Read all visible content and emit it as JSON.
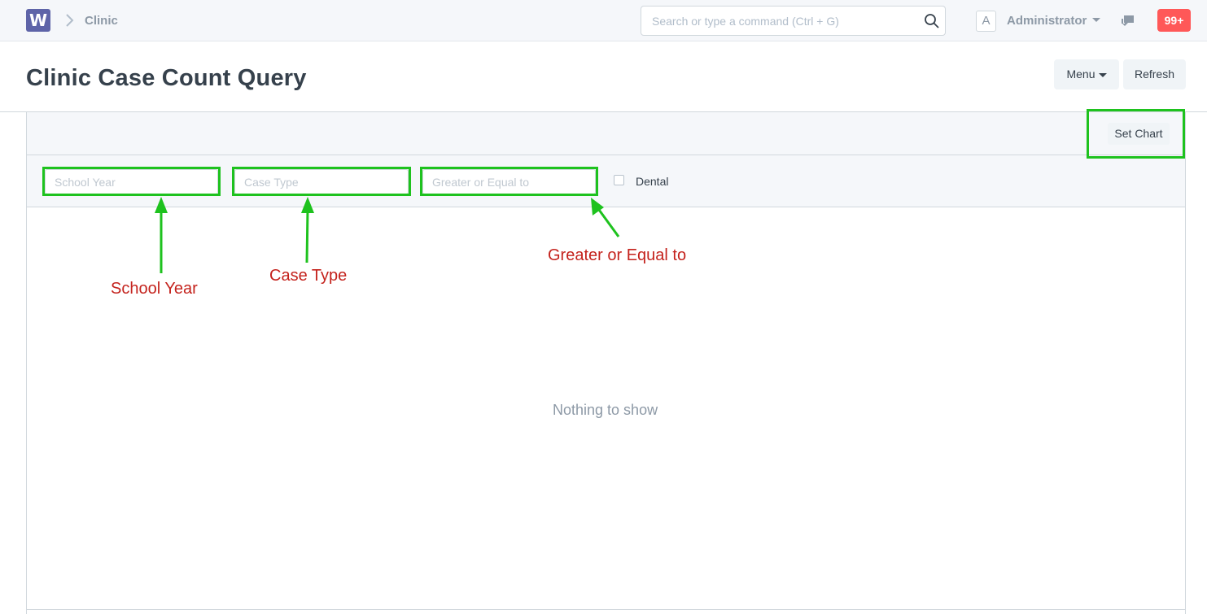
{
  "navbar": {
    "logo_letter": "W",
    "breadcrumb": "Clinic",
    "search_placeholder": "Search or type a command (Ctrl + G)",
    "avatar_letter": "A",
    "user_name": "Administrator",
    "notifications": "99+"
  },
  "page": {
    "title": "Clinic Case Count Query",
    "menu_label": "Menu",
    "refresh_label": "Refresh"
  },
  "report": {
    "set_chart_label": "Set Chart",
    "filters": {
      "school_year_placeholder": "School Year",
      "case_type_placeholder": "Case Type",
      "greater_equal_placeholder": "Greater or Equal to",
      "dental_label": "Dental"
    },
    "empty_message": "Nothing to show"
  },
  "annotations": {
    "school_year": "School Year",
    "case_type": "Case Type",
    "greater_equal": "Greater or Equal to"
  },
  "colors": {
    "annotation_box": "#1ec21e",
    "annotation_text": "#c4221c",
    "logo": "#5e64a8",
    "notification_badge": "#ff5858"
  }
}
